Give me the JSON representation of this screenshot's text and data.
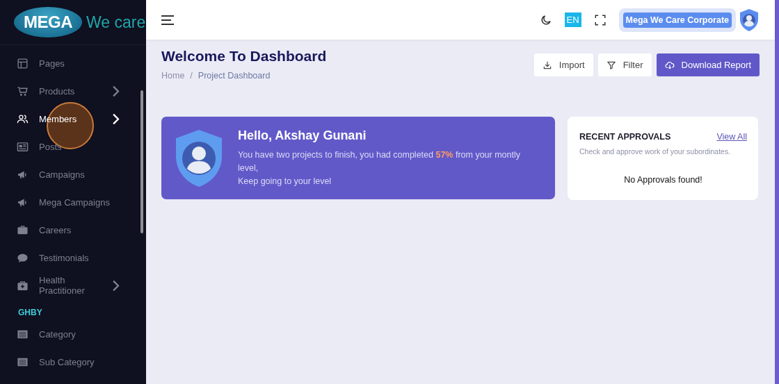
{
  "logo": {
    "brand": "MEGA",
    "tagline": "We care"
  },
  "sidebar": {
    "items": [
      {
        "label": "Pages",
        "has_submenu": false,
        "selected": false
      },
      {
        "label": "Products",
        "has_submenu": true,
        "selected": false
      },
      {
        "label": "Members",
        "has_submenu": true,
        "selected": true
      },
      {
        "label": "Posts",
        "has_submenu": false,
        "selected": false
      },
      {
        "label": "Campaigns",
        "has_submenu": false,
        "selected": false
      },
      {
        "label": "Mega Campaigns",
        "has_submenu": false,
        "selected": false
      },
      {
        "label": "Careers",
        "has_submenu": false,
        "selected": false
      },
      {
        "label": "Testimonials",
        "has_submenu": false,
        "selected": false
      },
      {
        "label": "Health Practitioner",
        "has_submenu": true,
        "selected": false
      }
    ],
    "section": {
      "title": "GHBY",
      "items": [
        {
          "label": "Category",
          "has_submenu": false,
          "selected": false
        },
        {
          "label": "Sub Category",
          "has_submenu": false,
          "selected": false
        }
      ]
    }
  },
  "topbar": {
    "language": "EN",
    "account": "Mega We Care Corporate"
  },
  "page": {
    "title": "Welcome To Dashboard",
    "breadcrumb": [
      "Home",
      "Project Dashboard"
    ],
    "breadcrumb_separator": "/",
    "actions": [
      {
        "label": "Import",
        "kind": "import"
      },
      {
        "label": "Filter",
        "kind": "filter"
      },
      {
        "label": "Download Report",
        "kind": "download"
      }
    ]
  },
  "welcome": {
    "greeting": "Hello, Akshay Gunani",
    "message": "You have two projects to finish, you had completed **57%** from your montly level,",
    "message_2": "Keep going to your level"
  },
  "approvals": {
    "title": "RECENT APPROVALS",
    "link": "View All",
    "subtitle": "Check and approve work of your subordinates.",
    "empty": "No Approvals found!"
  }
}
